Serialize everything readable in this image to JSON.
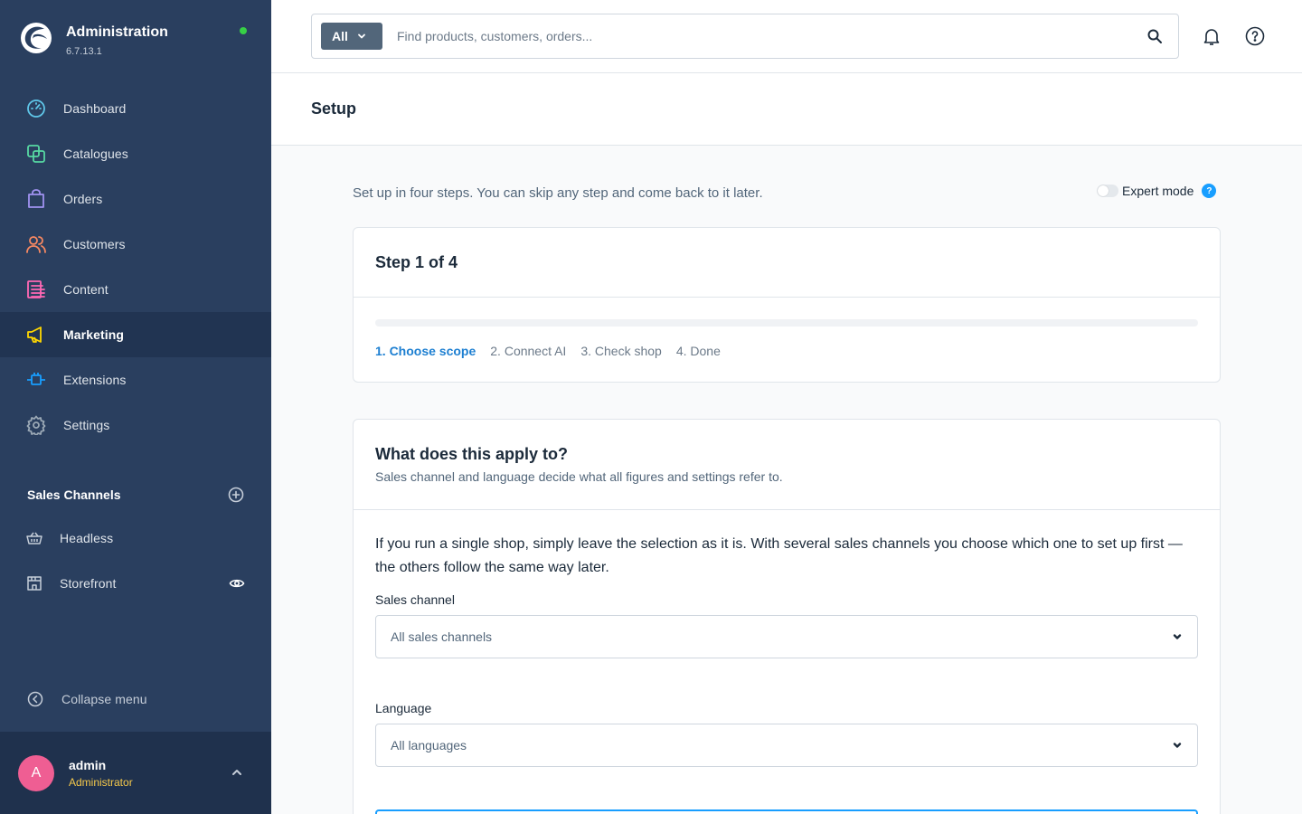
{
  "app": {
    "title": "Administration",
    "version": "6.7.13.1",
    "status_color": "#37d046"
  },
  "sidebar": {
    "items": [
      {
        "label": "Dashboard",
        "icon": "gauge-icon",
        "color": "#5fc6e8",
        "active": false
      },
      {
        "label": "Catalogues",
        "icon": "catalogue-icon",
        "color": "#57d9a3",
        "active": false
      },
      {
        "label": "Orders",
        "icon": "shopping-bag-icon",
        "color": "#a092f0",
        "active": false
      },
      {
        "label": "Customers",
        "icon": "users-icon",
        "color": "#f88962",
        "active": false
      },
      {
        "label": "Content",
        "icon": "content-icon",
        "color": "#ff68b4",
        "active": false
      },
      {
        "label": "Marketing",
        "icon": "megaphone-icon",
        "color": "#ffd700",
        "active": true
      },
      {
        "label": "Extensions",
        "icon": "plug-icon",
        "color": "#189eff",
        "active": false
      },
      {
        "label": "Settings",
        "icon": "gear-icon",
        "color": "#9aa8b5",
        "active": false
      }
    ],
    "sales_channels": {
      "title": "Sales Channels",
      "items": [
        {
          "label": "Headless",
          "icon": "basket-icon"
        },
        {
          "label": "Storefront",
          "icon": "storefront-icon"
        }
      ]
    },
    "collapse_label": "Collapse menu",
    "user": {
      "initial": "A",
      "name": "admin",
      "role": "Administrator"
    }
  },
  "topbar": {
    "search_type": "All",
    "search_placeholder": "Find products, customers, orders..."
  },
  "page": {
    "title": "Setup"
  },
  "intro": "Set up in four steps. You can skip any step and come back to it later.",
  "expert_mode": {
    "label": "Expert mode",
    "enabled": false,
    "help": "?"
  },
  "steps_card": {
    "title": "Step 1 of 4",
    "progress": 0,
    "steps": [
      "1. Choose scope",
      "2. Connect AI",
      "3. Check shop",
      "4. Done"
    ],
    "active_step": 0
  },
  "scope_card": {
    "title": "What does this apply to?",
    "subtitle": "Sales channel and language decide what all figures and settings refer to.",
    "text": "If you run a single shop, simply leave the selection as it is. With several sales channels you choose which one to set up first — the others follow the same way later.",
    "sales_channel_label": "Sales channel",
    "sales_channel_value": "All sales channels",
    "language_label": "Language",
    "language_value": "All languages"
  }
}
